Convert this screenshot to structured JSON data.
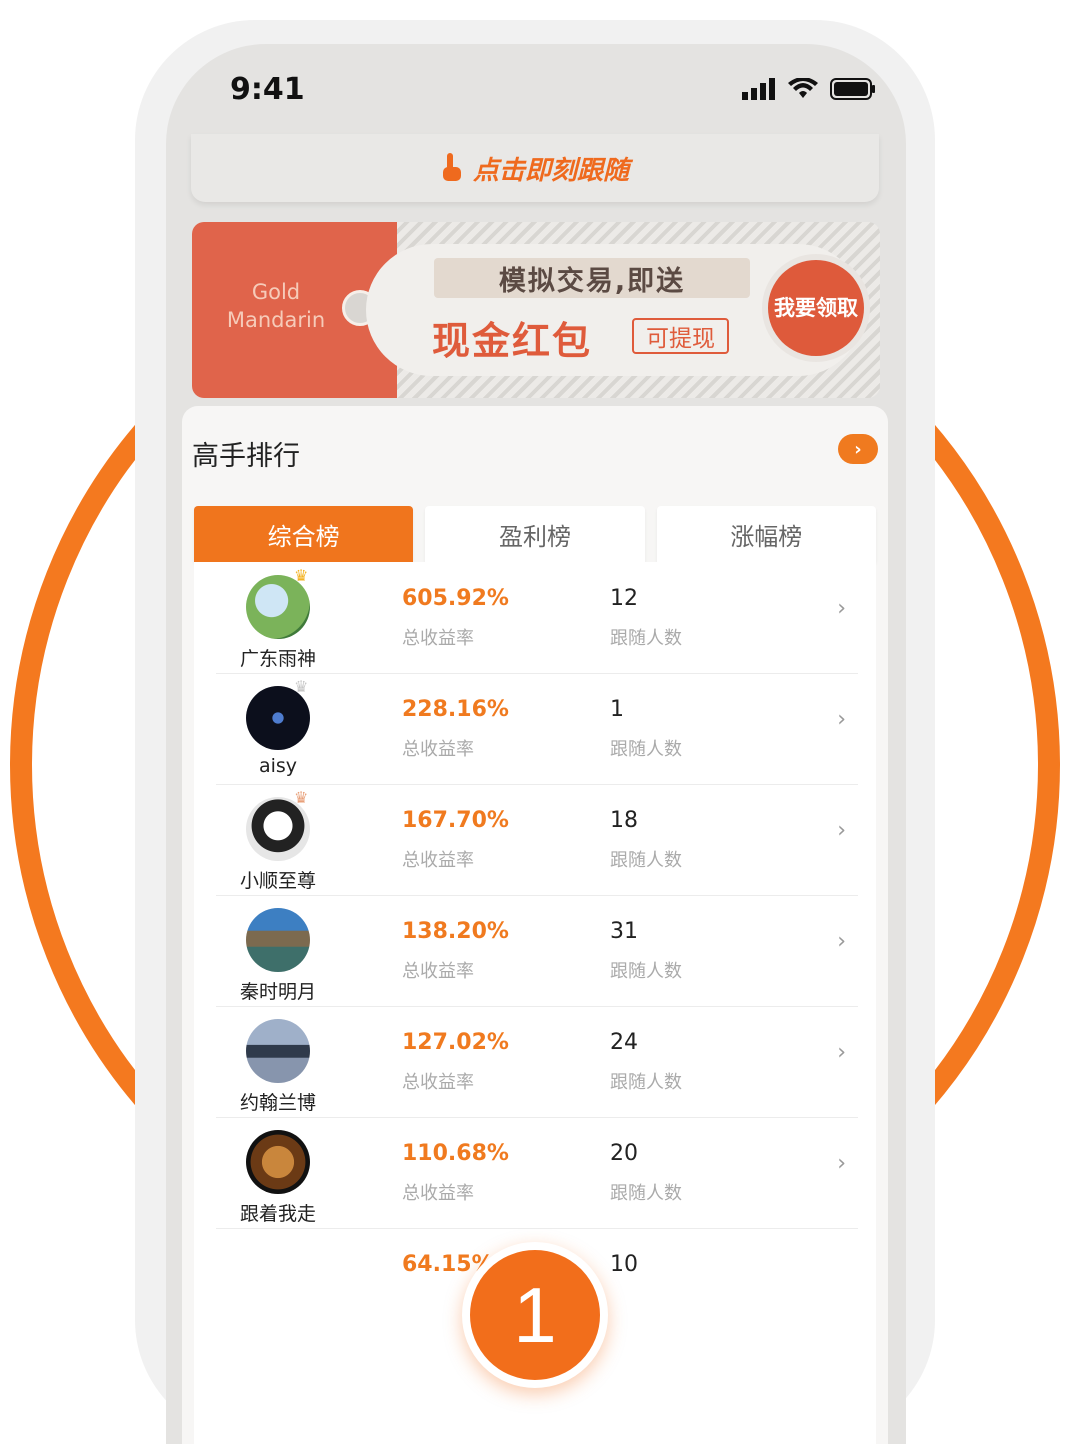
{
  "status_bar": {
    "time": "9:41"
  },
  "follow_bar": {
    "label": "点击即刻跟随"
  },
  "banner": {
    "envelope_text": "Gold Mandarin",
    "line1": "模拟交易,即送",
    "line2": "现金红包",
    "withdraw": "可提现",
    "claim": "我要领取"
  },
  "section": {
    "title": "高手排行"
  },
  "tabs": [
    {
      "label": "综合榜",
      "active": true
    },
    {
      "label": "盈利榜",
      "active": false
    },
    {
      "label": "涨幅榜",
      "active": false
    }
  ],
  "rank_list": [
    {
      "name": "广东雨神",
      "rate": "605.92%",
      "rate_label": "总收益率",
      "followers": "12",
      "followers_label": "跟随人数",
      "crown": "gold"
    },
    {
      "name": "aisy",
      "rate": "228.16%",
      "rate_label": "总收益率",
      "followers": "1",
      "followers_label": "跟随人数",
      "crown": "silver"
    },
    {
      "name": "小顺至尊",
      "rate": "167.70%",
      "rate_label": "总收益率",
      "followers": "18",
      "followers_label": "跟随人数",
      "crown": "bronze"
    },
    {
      "name": "秦时明月",
      "rate": "138.20%",
      "rate_label": "总收益率",
      "followers": "31",
      "followers_label": "跟随人数"
    },
    {
      "name": "约翰兰博",
      "rate": "127.02%",
      "rate_label": "总收益率",
      "followers": "24",
      "followers_label": "跟随人数"
    },
    {
      "name": "跟着我走",
      "rate": "110.68%",
      "rate_label": "总收益率",
      "followers": "20",
      "followers_label": "跟随人数"
    },
    {
      "name": "",
      "rate": "64.15%",
      "rate_label": "",
      "followers": "10",
      "followers_label": ""
    }
  ],
  "step_badge": "1",
  "colors": {
    "accent": "#f0751d",
    "ring": "#f4791f",
    "banner_red": "#e0644b"
  }
}
